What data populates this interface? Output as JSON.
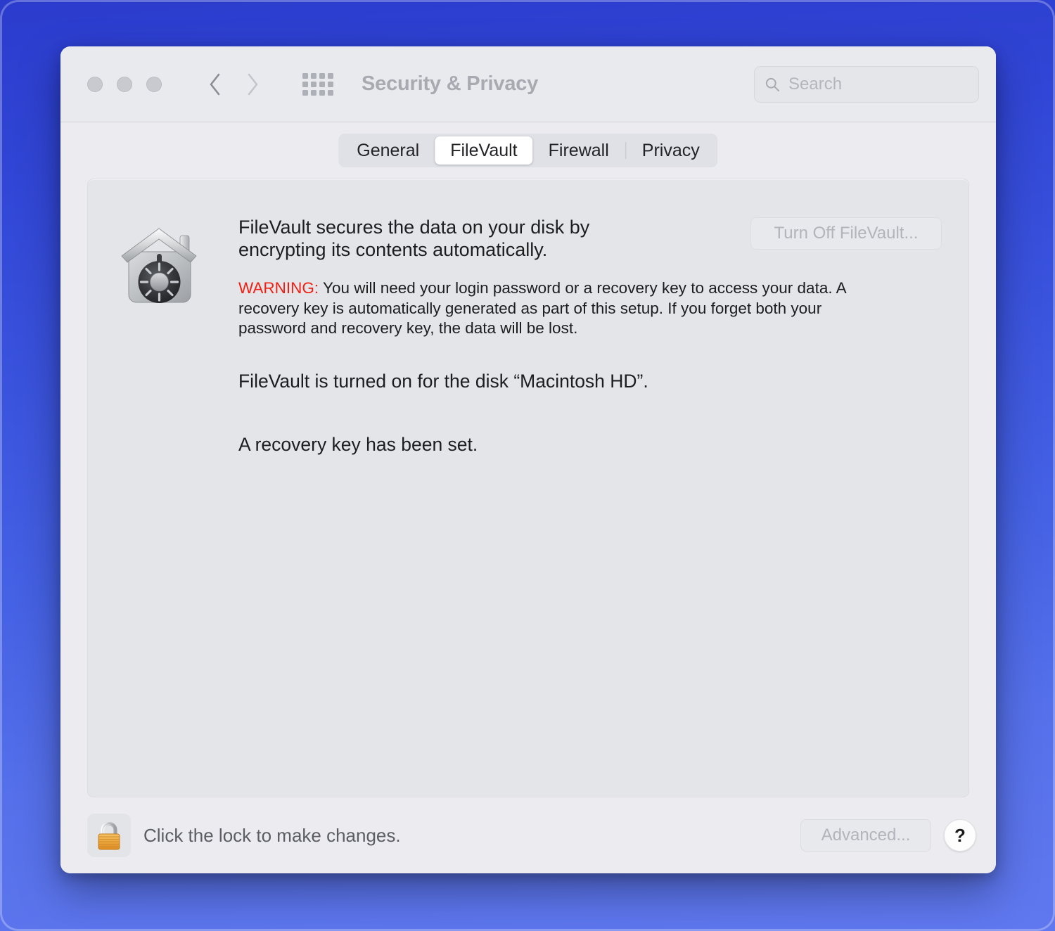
{
  "window": {
    "title": "Security & Privacy",
    "traffic_lights": [
      "close",
      "minimize",
      "zoom"
    ],
    "nav": {
      "back": "back-arrow",
      "forward": "forward-arrow"
    },
    "grid_button": "show-all-icon"
  },
  "search": {
    "placeholder": "Search",
    "value": "",
    "icon": "search-icon"
  },
  "tabs": [
    {
      "label": "General",
      "active": false
    },
    {
      "label": "FileVault",
      "active": true
    },
    {
      "label": "Firewall",
      "active": false
    },
    {
      "label": "Privacy",
      "active": false
    }
  ],
  "filevault": {
    "icon": "filevault-house-safe-icon",
    "intro": "FileVault secures the data on your disk by encrypting its contents automatically.",
    "warning_label": "WARNING:",
    "warning_text": "You will need your login password or a recovery key to access your data. A recovery key is automatically generated as part of this setup. If you forget both your password and recovery key, the data will be lost.",
    "status_line_1": "FileVault is turned on for the disk “Macintosh HD”.",
    "status_line_2": "A recovery key has been set.",
    "turn_off_button": "Turn Off FileVault..."
  },
  "bottom": {
    "lock_icon": "lock-closed-icon",
    "lock_label": "Click the lock to make changes.",
    "advanced_button": "Advanced...",
    "help_button": "?"
  },
  "colors": {
    "desktop_top": "#2b3ccd",
    "desktop_bottom": "#6078ef",
    "window_bg": "#ececf0",
    "toolbar_bg": "#e9eaee",
    "panel_bg": "#e4e5e9",
    "warning_red": "#f01f13",
    "text_primary": "#1c1d1f",
    "text_muted": "#b2b4bb",
    "title_gray": "#a8aab1"
  }
}
